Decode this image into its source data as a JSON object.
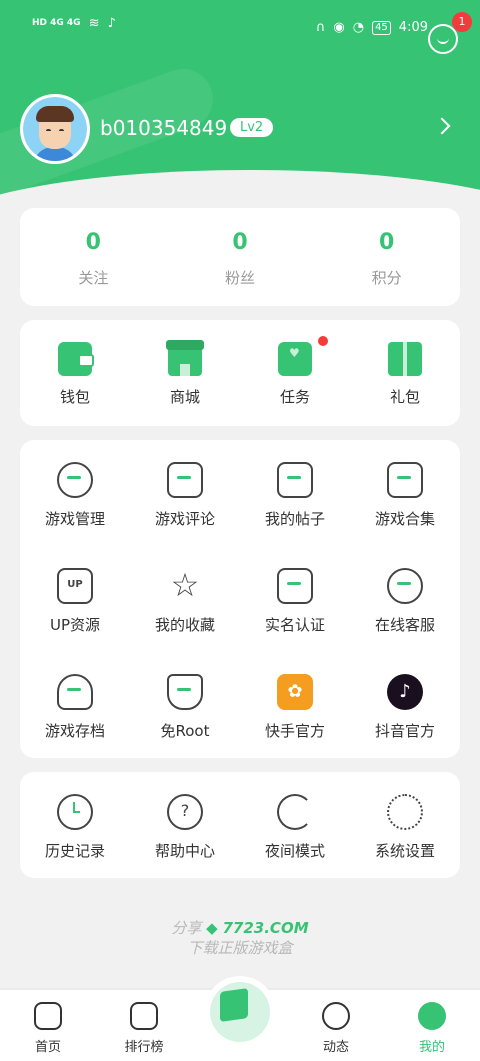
{
  "status_bar": {
    "left_network": "HD 4G 4G",
    "time": "4:09",
    "battery": "45"
  },
  "header": {
    "message_badge": "1"
  },
  "profile": {
    "username": "b010354849",
    "level": "Lv2"
  },
  "stats": [
    {
      "value": "0",
      "label": "关注"
    },
    {
      "value": "0",
      "label": "粉丝"
    },
    {
      "value": "0",
      "label": "积分"
    }
  ],
  "wallet_items": [
    {
      "label": "钱包",
      "icon": "wallet-icon"
    },
    {
      "label": "商城",
      "icon": "shop-icon"
    },
    {
      "label": "任务",
      "icon": "task-icon"
    },
    {
      "label": "礼包",
      "icon": "gift-icon"
    }
  ],
  "tools": [
    {
      "label": "游戏管理",
      "icon": "gamepad-icon"
    },
    {
      "label": "游戏评论",
      "icon": "comment-icon"
    },
    {
      "label": "我的帖子",
      "icon": "post-icon"
    },
    {
      "label": "游戏合集",
      "icon": "folder-plus-icon"
    },
    {
      "label": "UP资源",
      "icon": "up-icon",
      "glyph": "UP"
    },
    {
      "label": "我的收藏",
      "icon": "star-icon",
      "glyph": "☆"
    },
    {
      "label": "实名认证",
      "icon": "id-card-icon"
    },
    {
      "label": "在线客服",
      "icon": "headset-icon"
    },
    {
      "label": "游戏存档",
      "icon": "cloud-download-icon"
    },
    {
      "label": "免Root",
      "icon": "shield-icon"
    },
    {
      "label": "快手官方",
      "icon": "kuaishou-icon",
      "glyph": "✿"
    },
    {
      "label": "抖音官方",
      "icon": "douyin-icon",
      "glyph": "♪"
    }
  ],
  "misc": [
    {
      "label": "历史记录",
      "icon": "clock-icon"
    },
    {
      "label": "帮助中心",
      "icon": "help-icon",
      "glyph": "?"
    },
    {
      "label": "夜间模式",
      "icon": "moon-icon"
    },
    {
      "label": "系统设置",
      "icon": "gear-icon"
    }
  ],
  "share": {
    "prefix": "分享",
    "brand": "7723.COM",
    "tagline": "下载正版游戏盒"
  },
  "tabbar": [
    {
      "label": "首页",
      "icon": "home-icon"
    },
    {
      "label": "排行榜",
      "icon": "ranking-icon"
    },
    {
      "label": "",
      "icon": "game-box-icon"
    },
    {
      "label": "动态",
      "icon": "planet-icon"
    },
    {
      "label": "我的",
      "icon": "profile-icon",
      "active": true
    }
  ],
  "colors": {
    "accent": "#37c374",
    "badge": "#f23c3c",
    "background": "#f1f1f1"
  }
}
